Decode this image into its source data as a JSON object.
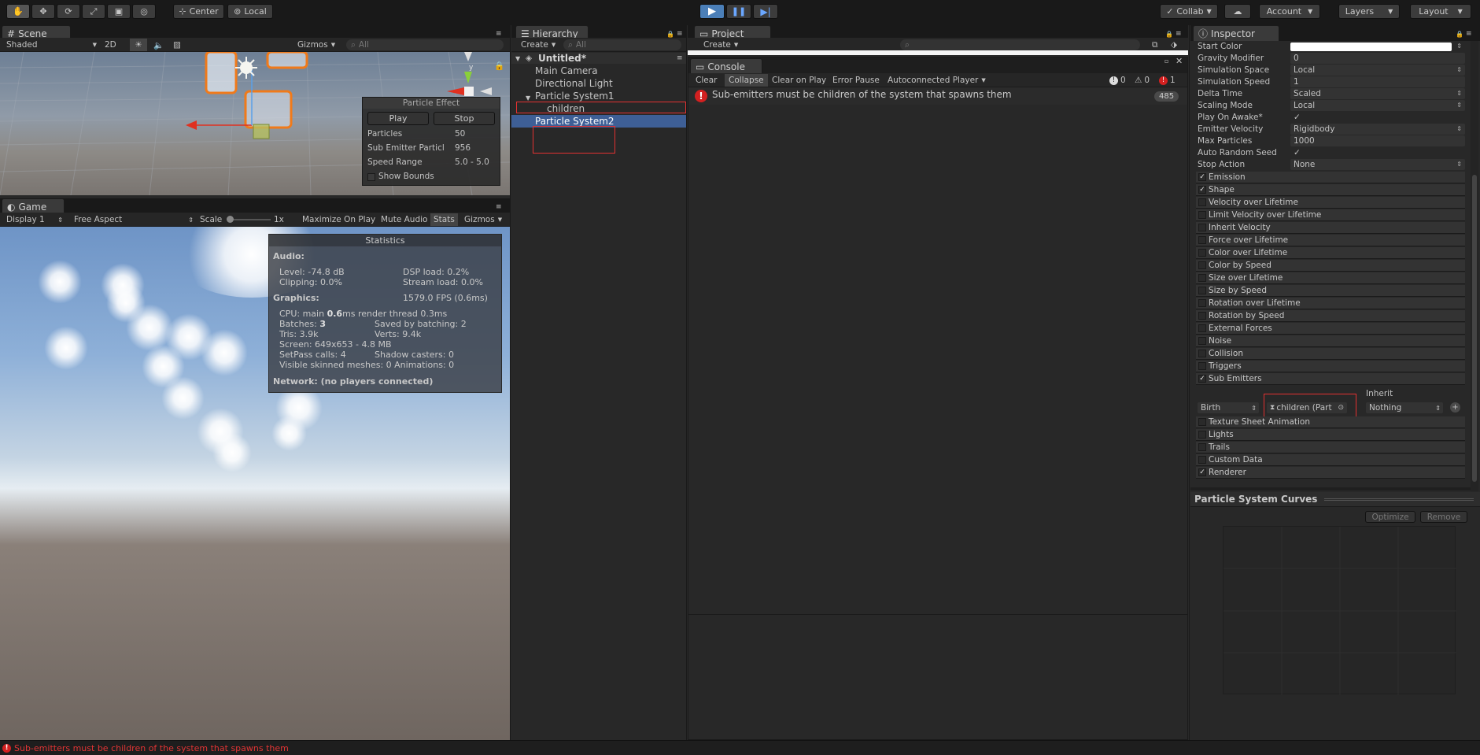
{
  "toolbar": {
    "center_label": "Center",
    "local_label": "Local",
    "collab_label": "Collab",
    "account_label": "Account",
    "layers_label": "Layers",
    "layout_label": "Layout"
  },
  "scene": {
    "tab_label": "Scene",
    "shading_mode": "Shaded",
    "mode_2d": "2D",
    "gizmos_label": "Gizmos",
    "search_placeholder": "All"
  },
  "particle_effect": {
    "title": "Particle Effect",
    "play_label": "Play",
    "stop_label": "Stop",
    "rows": [
      {
        "label": "Particles",
        "value": "50"
      },
      {
        "label": "Sub Emitter Particl",
        "value": "956"
      },
      {
        "label": "Speed Range",
        "value": "5.0 - 5.0"
      }
    ],
    "show_bounds_label": "Show Bounds"
  },
  "game": {
    "tab_label": "Game",
    "display": "Display 1",
    "aspect": "Free Aspect",
    "scale_label": "Scale",
    "scale_value": "1x",
    "maximize_label": "Maximize On Play",
    "mute_label": "Mute Audio",
    "stats_label": "Stats",
    "gizmos_label": "Gizmos"
  },
  "statistics": {
    "title": "Statistics",
    "audio_heading": "Audio:",
    "level": "Level: -74.8 dB",
    "dsp": "DSP load: 0.2%",
    "clipping": "Clipping: 0.0%",
    "stream": "Stream load: 0.0%",
    "graphics_heading": "Graphics:",
    "fps": "1579.0 FPS (0.6ms)",
    "cpu_prefix": "CPU: main ",
    "cpu_main": "0.6",
    "cpu_suffix": "ms  render thread 0.3ms",
    "batches_prefix": "Batches: ",
    "batches": "3",
    "saved_batching": "Saved by batching: 2",
    "tris": "Tris: 3.9k",
    "verts": "Verts: 9.4k",
    "screen": "Screen: 649x653 - 4.8 MB",
    "setpass": "SetPass calls: 4",
    "shadow_casters": "Shadow casters: 0",
    "skinned": "Visible skinned meshes: 0  Animations: 0",
    "network": "Network: (no players connected)"
  },
  "hierarchy": {
    "tab_label": "Hierarchy",
    "create_label": "Create",
    "search_placeholder": "All",
    "scene_name": "Untitled*",
    "items": [
      "Main Camera",
      "Directional Light",
      "Particle System1",
      "children",
      "Particle System2"
    ]
  },
  "project": {
    "tab_label": "Project",
    "create_label": "Create"
  },
  "console": {
    "tab_label": "Console",
    "buttons": [
      "Clear",
      "Collapse",
      "Clear on Play",
      "Error Pause",
      "Autoconnected Player"
    ],
    "log_count": "0",
    "warn_count": "0",
    "error_count": "1",
    "message": "Sub-emitters must be children of the system that spawns them",
    "message_count": "485"
  },
  "inspector": {
    "tab_label": "Inspector",
    "properties": [
      {
        "label": "Start Color",
        "value": ""
      },
      {
        "label": "Gravity Modifier",
        "value": "0"
      },
      {
        "label": "Simulation Space",
        "value": "Local"
      },
      {
        "label": "Simulation Speed",
        "value": "1"
      },
      {
        "label": "Delta Time",
        "value": "Scaled"
      },
      {
        "label": "Scaling Mode",
        "value": "Local"
      },
      {
        "label": "Play On Awake*",
        "value": "✓"
      },
      {
        "label": "Emitter Velocity",
        "value": "Rigidbody"
      },
      {
        "label": "Max Particles",
        "value": "1000"
      },
      {
        "label": "Auto Random Seed",
        "value": "✓"
      },
      {
        "label": "Stop Action",
        "value": "None"
      }
    ],
    "modules_top": [
      {
        "label": "Emission",
        "checked": true
      },
      {
        "label": "Shape",
        "checked": true
      },
      {
        "label": "Velocity over Lifetime",
        "checked": false
      },
      {
        "label": "Limit Velocity over Lifetime",
        "checked": false
      },
      {
        "label": "Inherit Velocity",
        "checked": false
      },
      {
        "label": "Force over Lifetime",
        "checked": false
      },
      {
        "label": "Color over Lifetime",
        "checked": false
      },
      {
        "label": "Color by Speed",
        "checked": false
      },
      {
        "label": "Size over Lifetime",
        "checked": false
      },
      {
        "label": "Size by Speed",
        "checked": false
      },
      {
        "label": "Rotation over Lifetime",
        "checked": false
      },
      {
        "label": "Rotation by Speed",
        "checked": false
      },
      {
        "label": "External Forces",
        "checked": false
      },
      {
        "label": "Noise",
        "checked": false
      },
      {
        "label": "Collision",
        "checked": false
      },
      {
        "label": "Triggers",
        "checked": false
      },
      {
        "label": "Sub Emitters",
        "checked": true
      }
    ],
    "sub_emitter": {
      "inherit_label": "Inherit",
      "type": "Birth",
      "object": "children (Part",
      "inherit_value": "Nothing"
    },
    "modules_bottom": [
      {
        "label": "Texture Sheet Animation",
        "checked": false
      },
      {
        "label": "Lights",
        "checked": false
      },
      {
        "label": "Trails",
        "checked": false
      },
      {
        "label": "Custom Data",
        "checked": false
      },
      {
        "label": "Renderer",
        "checked": true
      }
    ],
    "curves_title": "Particle System Curves",
    "optimize_label": "Optimize",
    "remove_label": "Remove"
  },
  "status_bar": {
    "message": "Sub-emitters must be children of the system that spawns them"
  }
}
